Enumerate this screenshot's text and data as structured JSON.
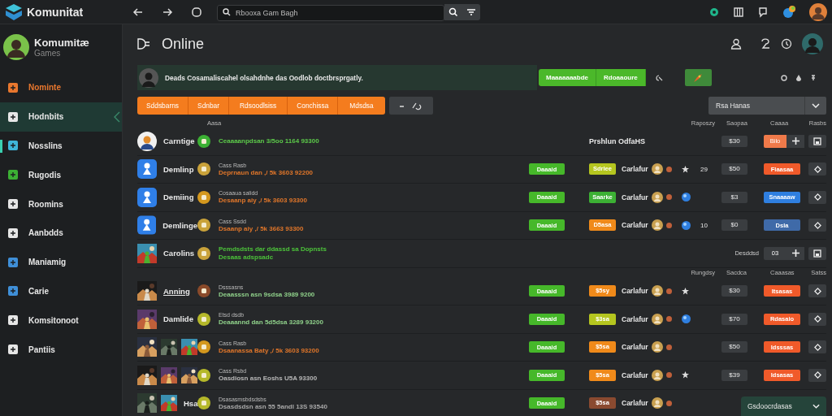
{
  "app": {
    "name": "Komunitat",
    "search": {
      "placeholder": "Rbooxa Gam Bagh"
    }
  },
  "sidebar": {
    "profile": {
      "name": "Komumitæ",
      "subtitle": "Games"
    },
    "items": [
      {
        "label": "Nominte",
        "color": "#e8772e",
        "accent": true,
        "selected": false,
        "indicator": false
      },
      {
        "label": "Hodnbits",
        "color": "#e6e6e6",
        "accent": false,
        "selected": true,
        "indicator": false
      },
      {
        "label": "Nosslins",
        "color": "#3fb6d8",
        "accent": false,
        "selected": false,
        "indicator": true
      },
      {
        "label": "Rugodis",
        "color": "#3cb034",
        "accent": false,
        "selected": false,
        "indicator": false
      },
      {
        "label": "Roomins",
        "color": "#e6e6e6",
        "accent": false,
        "selected": false,
        "indicator": false
      },
      {
        "label": "Aanbdds",
        "color": "#e6e6e6",
        "accent": false,
        "selected": false,
        "indicator": false
      },
      {
        "label": "Maniamig",
        "color": "#3f8fd8",
        "accent": false,
        "selected": false,
        "indicator": false
      },
      {
        "label": "Carie",
        "color": "#3f8fd8",
        "accent": false,
        "selected": false,
        "indicator": false
      },
      {
        "label": "Komsitonoot",
        "color": "#e6e6e6",
        "accent": false,
        "selected": false,
        "indicator": false
      },
      {
        "label": "Pantiis",
        "color": "#e6e6e6",
        "accent": false,
        "selected": false,
        "indicator": false
      }
    ]
  },
  "page": {
    "title": "Online"
  },
  "banner": {
    "text": "Deads Cosamaliscahel olsahdnhe das Oodlob doctbrsprgatly.",
    "buttons": [
      "Maaaaaaabde",
      "Rdoaaoure"
    ]
  },
  "tabs": [
    "Sddsbarns",
    "Sdnbar",
    "Rdsoodlsiss",
    "Conchissa",
    "Mdsdsa"
  ],
  "sort": {
    "value": "Rsa Hanas"
  },
  "table": {
    "rows": [
      {
        "kind": "header",
        "lead": "Aasa",
        "columns": [
          "Raposzy",
          "Saopaa",
          "Caaaa",
          "Rasbs"
        ]
      },
      {
        "kind": "featured",
        "thumbs": [
          {
            "kind": "avatar"
          }
        ],
        "name": "Carntige",
        "coin": {
          "color": "#3cb034"
        },
        "lines": [
          {
            "text": "Ceaaaanpdsan 3/5oo 1164 93300",
            "color": "#5cc94a"
          }
        ],
        "note": "Prshlun OdfaHS",
        "value": "$30",
        "action": {
          "label": "Bilo",
          "color": "#f07a4a"
        }
      },
      {
        "kind": "item",
        "thumbs": [
          {
            "kind": "app"
          }
        ],
        "name": "Demlinp",
        "coin": {
          "color": "#c9a23a"
        },
        "title": "Cass Rasb",
        "lines": [
          {
            "text": "Deprnaun dan ,/ 5k 3603 92200",
            "color": "#e0762a"
          }
        ],
        "status": "Daaaid",
        "tag": {
          "label": "Sdrlee",
          "color": "#b5c61f"
        },
        "who": "Carlafur",
        "extra": {
          "kind": "star"
        },
        "count": "29",
        "value": "$50",
        "action": {
          "label": "Flaasaa",
          "color": "#f05a2a"
        }
      },
      {
        "kind": "item",
        "thumbs": [
          {
            "kind": "app"
          }
        ],
        "name": "Demiing",
        "coin": {
          "color": "#d4981e"
        },
        "title": "Cosaaua salidd",
        "lines": [
          {
            "text": "Desaanp aiy ,/ 5k 3603 93300",
            "color": "#e0762a"
          }
        ],
        "status": "Daaaid",
        "tag": {
          "label": "Saarke",
          "color": "#3cb034"
        },
        "who": "Carlafur",
        "extra": {
          "kind": "globe"
        },
        "value": "$3",
        "action": {
          "label": "Snaaaaw",
          "color": "#2f7fe0"
        }
      },
      {
        "kind": "item",
        "thumbs": [
          {
            "kind": "app"
          }
        ],
        "name": "Demlinge",
        "coin": {
          "color": "#c9a23a"
        },
        "title": "Cass Ssdd",
        "lines": [
          {
            "text": "Dsaanp aiy ,/ 5k 3663 93300",
            "color": "#e0762a"
          }
        ],
        "status": "Daaaid",
        "tag": {
          "label": "D5asa",
          "color": "#f08a1a"
        },
        "who": "Carlafur",
        "extra": {
          "kind": "globe"
        },
        "count": "10",
        "value": "$0",
        "action": {
          "label": "Dsla",
          "color": "#3f6aa8"
        }
      },
      {
        "kind": "group",
        "thumbs": [
          {
            "kind": "picture"
          }
        ],
        "name": "Carolins",
        "coin": {
          "color": "#c9a23a"
        },
        "lines": [
          {
            "text": "Pemdsdsts dar ddassd sa Dopnsts",
            "color": "#4cc23a"
          },
          {
            "text": "Desaas adspsadc",
            "color": "#4cc23a"
          }
        ],
        "note": "Desddsd",
        "action": {
          "label": "03",
          "color": "#3a3d40"
        }
      },
      {
        "kind": "header",
        "columns": [
          "Rungdsy",
          "Sacdca",
          "Caaasas",
          "Satss"
        ]
      },
      {
        "kind": "item",
        "thumbs": [
          {
            "kind": "picture"
          }
        ],
        "name": "Anning",
        "underlined": true,
        "coin": {
          "color": "#8a4a2a"
        },
        "title": "Dsssasns",
        "lines": [
          {
            "text": "Deaasssn asn 9sdsa 3989 9200",
            "color": "#8fd08a"
          }
        ],
        "status": "Daaaid",
        "tag": {
          "label": "$5sy",
          "color": "#f08a1a"
        },
        "who": "Carlafur",
        "extra": {
          "kind": "star"
        },
        "value": "$30",
        "action": {
          "label": "Itsasas",
          "color": "#f05a2a"
        }
      },
      {
        "kind": "item",
        "thumbs": [
          {
            "kind": "picture"
          }
        ],
        "name": "Damlide",
        "coin": {
          "color": "#b5b82a"
        },
        "title": "Etsd dsdb",
        "lines": [
          {
            "text": "Deaaannd dan 5d5dsa 3289 93200",
            "color": "#8fd08a"
          }
        ],
        "status": "Daaaid",
        "tag": {
          "label": "$3sa",
          "color": "#b5c61f"
        },
        "who": "Carlafur",
        "extra": {
          "kind": "globe"
        },
        "value": "$70",
        "action": {
          "label": "Rdasaio",
          "color": "#f05a2a"
        }
      },
      {
        "kind": "item",
        "thumbs": [
          {
            "kind": "picture"
          },
          {
            "kind": "picture"
          },
          {
            "kind": "picture"
          }
        ],
        "coin": {
          "color": "#d4981e"
        },
        "title": "Cass Rasb",
        "lines": [
          {
            "text": "Dsaanassa Baty ,/ 5k 3603 93200",
            "color": "#e0762a"
          }
        ],
        "status": "Daaaid",
        "tag": {
          "label": "$5sa",
          "color": "#f08a1a"
        },
        "who": "Carlafur",
        "value": "$50",
        "action": {
          "label": "Idsssas",
          "color": "#f05a2a"
        }
      },
      {
        "kind": "item",
        "thumbs": [
          {
            "kind": "picture"
          },
          {
            "kind": "picture"
          },
          {
            "kind": "picture"
          }
        ],
        "coin": {
          "color": "#b5b82a"
        },
        "title": "Cass Rsbd",
        "lines": [
          {
            "text": "Oasdiosn asn Eoshs U5A 93300",
            "color": "#b8b8b8"
          }
        ],
        "status": "Daaaid",
        "tag": {
          "label": "$5sa",
          "color": "#f08a1a"
        },
        "who": "Carlafur",
        "extra": {
          "kind": "star"
        },
        "value": "$39",
        "action": {
          "label": "Idsasas",
          "color": "#f05a2a"
        }
      },
      {
        "kind": "item",
        "thumbs": [
          {
            "kind": "picture"
          },
          {
            "kind": "picture"
          }
        ],
        "name": "Hsa",
        "coin": {
          "color": "#b5b82a"
        },
        "title": "Dsasasmsbdsdsbs",
        "lines": [
          {
            "text": "Dsasdsdsn asn 55 5andl 13S 93540",
            "color": "#a8a8a8"
          }
        ],
        "status": "Daaaid",
        "tag": {
          "label": "$5sa",
          "color": "#8a4a30"
        },
        "who": "Carlafur"
      }
    ]
  },
  "footer_menu": {
    "label": "Gsdoocrdasas"
  }
}
